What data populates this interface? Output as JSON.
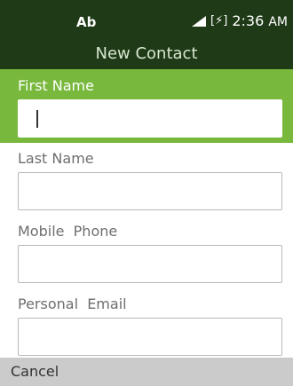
{
  "status_bar": {
    "input_mode": "Ab",
    "time": "2:36",
    "ampm": "AM",
    "icons": [
      "signal-icon",
      "battery-charging-icon"
    ]
  },
  "header": {
    "title": "New Contact"
  },
  "form": {
    "fields": [
      {
        "label": "First Name",
        "value": "",
        "focused": true
      },
      {
        "label": "Last Name",
        "value": ""
      },
      {
        "label": "Mobile  Phone",
        "value": ""
      },
      {
        "label": "Personal  Email",
        "value": ""
      }
    ]
  },
  "softkeys": {
    "left": "Cancel"
  },
  "colors": {
    "header_bg": "#1f3a16",
    "accent": "#78b83c",
    "softkey_bg": "#cbcbcb"
  }
}
